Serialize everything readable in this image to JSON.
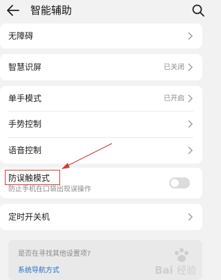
{
  "header": {
    "title": "智能辅助",
    "back_icon": "arrow-left-icon",
    "search_icon": "search-icon"
  },
  "sections": [
    {
      "items": [
        {
          "label": "无障碍"
        }
      ]
    },
    {
      "items": [
        {
          "label": "智慧识屏",
          "status": "已关闭"
        }
      ]
    },
    {
      "items": [
        {
          "label": "单手模式",
          "status": "已开启"
        },
        {
          "label": "手势控制"
        },
        {
          "label": "语音控制"
        }
      ]
    },
    {
      "items": [
        {
          "label": "防误触模式",
          "subtitle": "防止手机在口袋出现误操作",
          "toggle_on": false
        }
      ]
    },
    {
      "items": [
        {
          "label": "定时开关机"
        }
      ]
    }
  ],
  "tip": {
    "question": "是否在寻找其他设置项?",
    "link": "系统导航方式"
  },
  "colors": {
    "annotation": "#d23a3a",
    "link": "#1f6fd6",
    "background": "#f2f2f2"
  },
  "watermark": {
    "text": "Baidu 经验"
  }
}
